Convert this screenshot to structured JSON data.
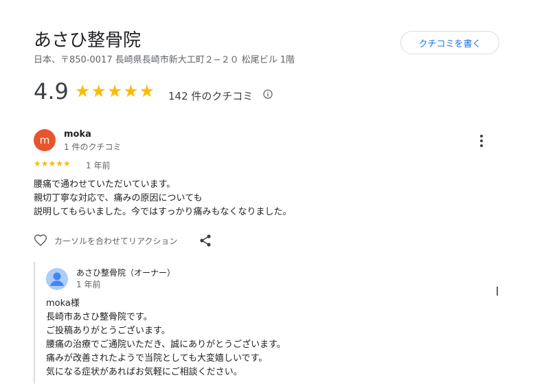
{
  "place": {
    "name": "あさひ整骨院",
    "address": "日本、〒850-0017 長崎県長崎市新大工町２−２０ 松尾ビル 1階",
    "write_review_label": "クチコミを書く",
    "rating": "4.9",
    "rating_stars": "★★★★★",
    "review_count_label": "142 件のクチコミ"
  },
  "review": {
    "avatar_letter": "m",
    "avatar_color": "#e8542c",
    "author": "moka",
    "author_meta": "1 件のクチコミ",
    "stars": "★★★★★",
    "time": "1 年前",
    "body": [
      "腰痛で通わせていただいています。",
      "親切丁寧な対応で、痛みの原因についても",
      "説明してもらいました。今ではすっかり痛みもなくなりました。"
    ],
    "reaction_label": "カーソルを合わせてリアクション"
  },
  "owner_reply": {
    "author": "あさひ整骨院（オーナー）",
    "time": "1 年前",
    "body": [
      "moka様",
      "長崎市あさひ整骨院です。",
      "ご投稿ありがとうございます。",
      "腰痛の治療でご通院いただき、誠にありがとうございます。",
      "痛みが改善されたようで当院としても大変嬉しいです。",
      "気になる症状があればお気軽にご相談ください。"
    ]
  },
  "colors": {
    "star": "#fbbc04",
    "accent": "#1a73e8"
  },
  "icons": [
    "info-icon",
    "more-vert-icon",
    "heart-icon",
    "share-icon",
    "owner-avatar-icon"
  ]
}
